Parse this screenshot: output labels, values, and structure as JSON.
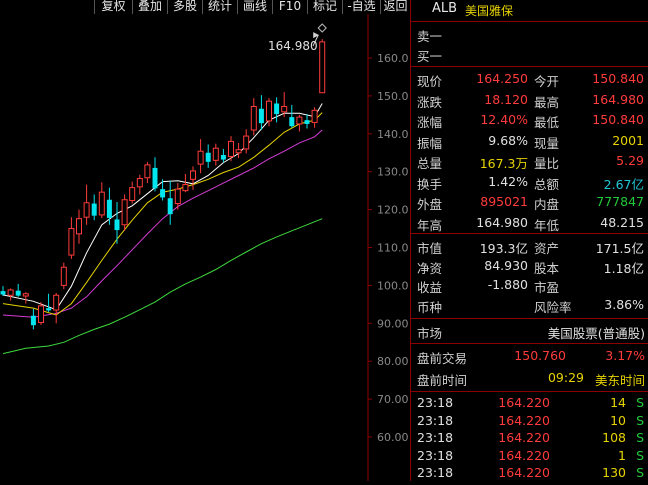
{
  "toolbar": {
    "buttons": [
      "复权",
      "叠加",
      "多股",
      "统计",
      "画线",
      "F10",
      "标记",
      "-自选",
      "返回"
    ]
  },
  "chart": {
    "max_label": "164.980",
    "y_axis_labels": [
      "160.0",
      "150.0",
      "140.0",
      "130.0",
      "120.0",
      "110.0",
      "100.0",
      "90.00",
      "80.00",
      "70.00",
      "60.00"
    ],
    "y_axis_values": [
      160,
      150,
      140,
      130,
      120,
      110,
      100,
      90,
      80,
      70,
      60
    ],
    "colors": {
      "up": "#ff3b3b",
      "down": "#00e5ee",
      "ma5": "#ffffff",
      "ma10": "#e6d300",
      "ma20": "#d63cd6",
      "ma60": "#3fd93f"
    }
  },
  "chart_data": {
    "type": "candlestick",
    "ylim": [
      55,
      172
    ],
    "candles": [
      {
        "o": 98.5,
        "h": 99.8,
        "l": 97.2,
        "c": 97.6
      },
      {
        "o": 97.4,
        "h": 99.2,
        "l": 96.0,
        "c": 98.8
      },
      {
        "o": 98.6,
        "h": 100.4,
        "l": 97.0,
        "c": 97.3
      },
      {
        "o": 97.2,
        "h": 98.2,
        "l": 95.2,
        "c": 97.8
      },
      {
        "o": 92.0,
        "h": 93.8,
        "l": 88.4,
        "c": 89.5
      },
      {
        "o": 90.2,
        "h": 95.6,
        "l": 89.6,
        "c": 94.6
      },
      {
        "o": 94.0,
        "h": 97.8,
        "l": 93.0,
        "c": 93.4
      },
      {
        "o": 93.5,
        "h": 98.0,
        "l": 90.0,
        "c": 97.4
      },
      {
        "o": 100.0,
        "h": 106.0,
        "l": 99.0,
        "c": 104.8
      },
      {
        "o": 108.0,
        "h": 118.0,
        "l": 107.0,
        "c": 115.0
      },
      {
        "o": 113.6,
        "h": 120.0,
        "l": 111.0,
        "c": 117.6
      },
      {
        "o": 118.0,
        "h": 126.6,
        "l": 116.0,
        "c": 121.8
      },
      {
        "o": 121.6,
        "h": 124.0,
        "l": 117.2,
        "c": 118.4
      },
      {
        "o": 118.6,
        "h": 127.2,
        "l": 117.8,
        "c": 124.6
      },
      {
        "o": 122.6,
        "h": 125.8,
        "l": 116.0,
        "c": 117.8
      },
      {
        "o": 117.4,
        "h": 122.0,
        "l": 111.0,
        "c": 114.6
      },
      {
        "o": 116.0,
        "h": 124.0,
        "l": 114.4,
        "c": 122.6
      },
      {
        "o": 122.4,
        "h": 127.4,
        "l": 121.6,
        "c": 125.8
      },
      {
        "o": 126.0,
        "h": 129.2,
        "l": 124.0,
        "c": 128.2
      },
      {
        "o": 128.4,
        "h": 132.6,
        "l": 127.0,
        "c": 131.8
      },
      {
        "o": 131.0,
        "h": 133.8,
        "l": 124.8,
        "c": 125.6
      },
      {
        "o": 125.4,
        "h": 128.0,
        "l": 122.4,
        "c": 123.2
      },
      {
        "o": 123.0,
        "h": 127.6,
        "l": 116.0,
        "c": 118.8
      },
      {
        "o": 121.6,
        "h": 127.0,
        "l": 120.0,
        "c": 125.4
      },
      {
        "o": 125.0,
        "h": 129.4,
        "l": 124.6,
        "c": 126.6
      },
      {
        "o": 128.0,
        "h": 131.4,
        "l": 125.2,
        "c": 130.2
      },
      {
        "o": 132.0,
        "h": 138.6,
        "l": 129.6,
        "c": 135.4
      },
      {
        "o": 135.0,
        "h": 137.2,
        "l": 131.0,
        "c": 132.6
      },
      {
        "o": 133.0,
        "h": 137.4,
        "l": 131.6,
        "c": 136.2
      },
      {
        "o": 134.4,
        "h": 136.0,
        "l": 132.4,
        "c": 133.2
      },
      {
        "o": 134.0,
        "h": 139.4,
        "l": 132.8,
        "c": 138.0
      },
      {
        "o": 135.0,
        "h": 137.6,
        "l": 133.6,
        "c": 135.8
      },
      {
        "o": 136.0,
        "h": 141.2,
        "l": 134.8,
        "c": 139.4
      },
      {
        "o": 141.0,
        "h": 149.4,
        "l": 139.6,
        "c": 147.2
      },
      {
        "o": 146.6,
        "h": 150.2,
        "l": 141.0,
        "c": 142.8
      },
      {
        "o": 143.4,
        "h": 149.4,
        "l": 142.0,
        "c": 148.6
      },
      {
        "o": 148.0,
        "h": 149.6,
        "l": 143.0,
        "c": 145.2
      },
      {
        "o": 145.8,
        "h": 151.0,
        "l": 144.4,
        "c": 147.2
      },
      {
        "o": 144.4,
        "h": 147.6,
        "l": 141.6,
        "c": 142.0
      },
      {
        "o": 142.6,
        "h": 145.0,
        "l": 140.6,
        "c": 144.4
      },
      {
        "o": 143.6,
        "h": 145.2,
        "l": 141.4,
        "c": 142.6
      },
      {
        "o": 143.0,
        "h": 147.0,
        "l": 141.6,
        "c": 146.2
      },
      {
        "o": 150.84,
        "h": 164.98,
        "l": 150.84,
        "c": 164.25
      }
    ],
    "ma5": [
      [
        0,
        97.5
      ],
      [
        4,
        95.8
      ],
      [
        7,
        93.6
      ],
      [
        9,
        99.8
      ],
      [
        11,
        108.6
      ],
      [
        13,
        116.0
      ],
      [
        15,
        119.0
      ],
      [
        17,
        121.0
      ],
      [
        19,
        124.2
      ],
      [
        21,
        127.4
      ],
      [
        23,
        127.6
      ],
      [
        25,
        126.8
      ],
      [
        27,
        129.0
      ],
      [
        29,
        132.4
      ],
      [
        31,
        134.8
      ],
      [
        33,
        139.0
      ],
      [
        35,
        143.6
      ],
      [
        37,
        145.4
      ],
      [
        39,
        145.4
      ],
      [
        41,
        144.5
      ],
      [
        42,
        148.0
      ]
    ],
    "ma10": [
      [
        0,
        95.2
      ],
      [
        4,
        94.0
      ],
      [
        7,
        92.2
      ],
      [
        9,
        95.2
      ],
      [
        11,
        100.8
      ],
      [
        13,
        106.6
      ],
      [
        15,
        112.2
      ],
      [
        17,
        117.2
      ],
      [
        19,
        121.8
      ],
      [
        21,
        124.6
      ],
      [
        23,
        125.4
      ],
      [
        25,
        126.6
      ],
      [
        27,
        128.0
      ],
      [
        29,
        129.8
      ],
      [
        31,
        131.2
      ],
      [
        33,
        133.8
      ],
      [
        35,
        137.0
      ],
      [
        37,
        140.4
      ],
      [
        39,
        142.6
      ],
      [
        41,
        143.6
      ],
      [
        42,
        145.6
      ]
    ],
    "ma20": [
      [
        0,
        92.2
      ],
      [
        4,
        91.6
      ],
      [
        7,
        92.6
      ],
      [
        9,
        94.0
      ],
      [
        11,
        97.0
      ],
      [
        13,
        101.2
      ],
      [
        15,
        105.2
      ],
      [
        17,
        109.4
      ],
      [
        19,
        113.6
      ],
      [
        21,
        117.6
      ],
      [
        23,
        120.8
      ],
      [
        25,
        123.0
      ],
      [
        27,
        125.0
      ],
      [
        29,
        127.0
      ],
      [
        31,
        129.0
      ],
      [
        33,
        131.0
      ],
      [
        35,
        133.4
      ],
      [
        37,
        135.4
      ],
      [
        39,
        137.6
      ],
      [
        41,
        139.2
      ],
      [
        42,
        141.0
      ]
    ],
    "ma60": [
      [
        0,
        82.0
      ],
      [
        3,
        83.4
      ],
      [
        6,
        84.0
      ],
      [
        8,
        85.0
      ],
      [
        10,
        86.8
      ],
      [
        12,
        88.4
      ],
      [
        14,
        89.8
      ],
      [
        16,
        91.6
      ],
      [
        18,
        93.6
      ],
      [
        20,
        95.6
      ],
      [
        22,
        98.2
      ],
      [
        24,
        100.4
      ],
      [
        26,
        102.2
      ],
      [
        28,
        104.2
      ],
      [
        30,
        106.6
      ],
      [
        32,
        108.8
      ],
      [
        34,
        111.0
      ],
      [
        36,
        112.8
      ],
      [
        38,
        114.4
      ],
      [
        40,
        116.0
      ],
      [
        42,
        117.6
      ]
    ]
  },
  "panel": {
    "symbol": "ALB",
    "name": "美国雅保",
    "sell1": "卖一",
    "buy1": "买一",
    "rows": [
      {
        "l1": "现价",
        "v1": "164.250",
        "c1": "red",
        "l2": "今开",
        "v2": "150.840",
        "c2": "red"
      },
      {
        "l1": "涨跌",
        "v1": "18.120",
        "c1": "red",
        "l2": "最高",
        "v2": "164.980",
        "c2": "red"
      },
      {
        "l1": "涨幅",
        "v1": "12.40%",
        "c1": "red",
        "l2": "最低",
        "v2": "150.840",
        "c2": "red"
      },
      {
        "l1": "振幅",
        "v1": "9.68%",
        "c1": "white",
        "l2": "现量",
        "v2": "2001",
        "c2": "yellow"
      },
      {
        "l1": "总量",
        "v1": "167.3万",
        "c1": "yellow",
        "l2": "量比",
        "v2": "5.29",
        "c2": "red"
      },
      {
        "l1": "换手",
        "v1": "1.42%",
        "c1": "white",
        "l2": "总额",
        "v2": "2.67亿",
        "c2": "cyan"
      },
      {
        "l1": "外盘",
        "v1": "895021",
        "c1": "red",
        "l2": "内盘",
        "v2": "777847",
        "c2": "green"
      },
      {
        "l1": "年高",
        "v1": "164.980",
        "c1": "white",
        "l2": "年低",
        "v2": "48.215",
        "c2": "white"
      }
    ],
    "rows2": [
      {
        "l1": "市值",
        "v1": "193.3亿",
        "l2": "资产",
        "v2": "171.5亿"
      },
      {
        "l1": "净资",
        "v1": "84.930",
        "l2": "股本",
        "v2": "1.18亿"
      },
      {
        "l1": "收益",
        "v1": "-1.880",
        "l2": "市盈",
        "v2": ""
      },
      {
        "l1": "币种",
        "v1": "",
        "l2": "风险率",
        "v2": "3.86%"
      }
    ],
    "market_label": "市场",
    "market_value": "美国股票(普通股)",
    "premarket_label": "盘前交易",
    "premarket_price": "150.760",
    "premarket_pct": "3.17%",
    "premarket_time_label": "盘前时间",
    "premarket_time": "09:29",
    "premarket_tz": "美东时间",
    "ticks": [
      {
        "t": "23:18",
        "p": "164.220",
        "v": "14",
        "s": "S"
      },
      {
        "t": "23:18",
        "p": "164.220",
        "v": "10",
        "s": "S"
      },
      {
        "t": "23:18",
        "p": "164.220",
        "v": "108",
        "s": "S"
      },
      {
        "t": "23:18",
        "p": "164.220",
        "v": "1",
        "s": "S"
      },
      {
        "t": "23:18",
        "p": "164.220",
        "v": "130",
        "s": "S"
      }
    ]
  }
}
